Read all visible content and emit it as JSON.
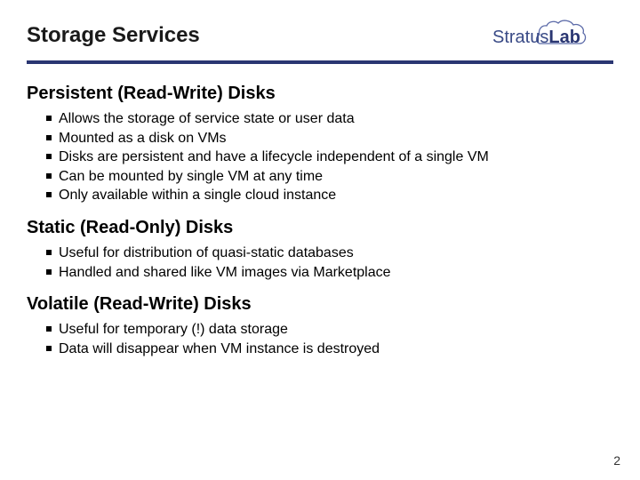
{
  "header": {
    "title": "Storage Services",
    "logo_text_a": "Stratus",
    "logo_text_b": "Lab"
  },
  "sections": [
    {
      "heading": "Persistent (Read-Write) Disks",
      "items": [
        "Allows the storage of service state or user data",
        "Mounted as a disk on VMs",
        "Disks are persistent and have a lifecycle independent of a single VM",
        "Can be mounted by single VM at any time",
        "Only available within a single cloud instance"
      ]
    },
    {
      "heading": "Static (Read-Only) Disks",
      "items": [
        "Useful for distribution of quasi-static databases",
        "Handled and shared like VM images via Marketplace"
      ]
    },
    {
      "heading": "Volatile (Read-Write) Disks",
      "items": [
        "Useful for temporary (!) data storage",
        "Data will disappear when VM instance is destroyed"
      ]
    }
  ],
  "page_number": "2"
}
